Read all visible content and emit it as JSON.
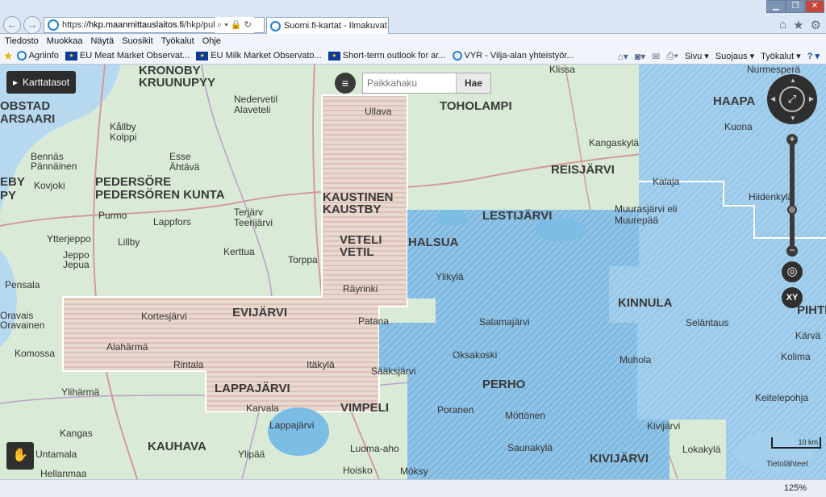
{
  "browser": {
    "url_prefix": "https://",
    "url_domain": "hkp.maanmittauslaitos.fi",
    "url_rest": "/hkp/published",
    "tab_title": "Suomi.fi-kartat - Ilmakuvat ...",
    "tab_close": "✕",
    "nav_back": "←",
    "nav_forward": "→",
    "addr_icons": "⌕ ▾ 🔒 ↻"
  },
  "menu": [
    "Tiedosto",
    "Muokkaa",
    "Näytä",
    "Suosikit",
    "Työkalut",
    "Ohje"
  ],
  "favorites": [
    {
      "label": "Agriinfo",
      "icon": "ie-icon"
    },
    {
      "label": "EU Meat Market Observat...",
      "icon": "eu-flag-icon"
    },
    {
      "label": "EU Milk Market Observato...",
      "icon": "eu-flag-icon"
    },
    {
      "label": "Short-term outlook for ar...",
      "icon": "eu-flag-icon"
    },
    {
      "label": "VYR - Vilja-alan yhteistyör...",
      "icon": "ie-icon"
    }
  ],
  "command_bar": {
    "sivu": "Sivu ▾",
    "suojaus": "Suojaus ▾",
    "tyokalut": "Työkalut ▾",
    "help": "? ▾"
  },
  "map_ui": {
    "layers_label": "Karttatasot",
    "search_placeholder": "Paikkahaku",
    "search_button": "Hae",
    "xy_label": "XY",
    "scale_label": "10 km",
    "credits": "Tietolähteet",
    "compass_center": "⤢",
    "menu_glyph": "≡",
    "zoom_in": "+",
    "zoom_out": "−",
    "locate_glyph": "◎",
    "tool_glyph": "✋"
  },
  "places": [
    {
      "name": "KRONOBY",
      "big": true
    },
    {
      "name": "KRUUNUPYY",
      "big": true
    },
    {
      "name": "OBSTAD",
      "big": true
    },
    {
      "name": "ARSAARI",
      "big": true
    },
    {
      "name": "Nedervetil",
      "big": false
    },
    {
      "name": "Alaveteli",
      "big": false
    },
    {
      "name": "Ullava",
      "big": false
    },
    {
      "name": "TOHOLAMPI",
      "big": true
    },
    {
      "name": "HAAPA",
      "big": true
    },
    {
      "name": "Kuona",
      "big": false
    },
    {
      "name": "Kållby",
      "big": false
    },
    {
      "name": "Kolppi",
      "big": false
    },
    {
      "name": "Bennäs",
      "big": false
    },
    {
      "name": "Pännäinen",
      "big": false
    },
    {
      "name": "Esse",
      "big": false
    },
    {
      "name": "Ähtävä",
      "big": false
    },
    {
      "name": "Kangaskylä",
      "big": false
    },
    {
      "name": "REISJÄRVI",
      "big": true
    },
    {
      "name": "EBY",
      "big": true
    },
    {
      "name": "PY",
      "big": true
    },
    {
      "name": "Kovjoki",
      "big": false
    },
    {
      "name": "PEDERSÖRE",
      "big": true
    },
    {
      "name": "PEDERSÖREN KUNTA",
      "big": true
    },
    {
      "name": "KAUSTINEN",
      "big": true
    },
    {
      "name": "KAUSTBY",
      "big": true
    },
    {
      "name": "Kalaja",
      "big": false
    },
    {
      "name": "Hiidenkylä",
      "big": false
    },
    {
      "name": "Purmo",
      "big": false
    },
    {
      "name": "Terjärv",
      "big": false
    },
    {
      "name": "Teerijärvi",
      "big": false
    },
    {
      "name": "LESTIJÄRVI",
      "big": true
    },
    {
      "name": "Muurasjärvi eli",
      "big": false
    },
    {
      "name": "Muurepää",
      "big": false
    },
    {
      "name": "Lappfors",
      "big": false
    },
    {
      "name": "Ytterjeppo",
      "big": false
    },
    {
      "name": "Lillby",
      "big": false
    },
    {
      "name": "VETELI",
      "big": true
    },
    {
      "name": "VETIL",
      "big": true
    },
    {
      "name": "HALSUA",
      "big": true
    },
    {
      "name": "Jeppo",
      "big": false
    },
    {
      "name": "Jepua",
      "big": false
    },
    {
      "name": "Kerttua",
      "big": false
    },
    {
      "name": "Torppa",
      "big": false
    },
    {
      "name": "Ylikylä",
      "big": false
    },
    {
      "name": "KINNULA",
      "big": true
    },
    {
      "name": "PIHTIPU",
      "big": true
    },
    {
      "name": "Pensala",
      "big": false
    },
    {
      "name": "Räyrinki",
      "big": false
    },
    {
      "name": "Oravais",
      "big": false
    },
    {
      "name": "Oravainen",
      "big": false
    },
    {
      "name": "Kortesjärvi",
      "big": false
    },
    {
      "name": "EVIJÄRVI",
      "big": true
    },
    {
      "name": "Salamajärvi",
      "big": false
    },
    {
      "name": "Seläntaus",
      "big": false
    },
    {
      "name": "Patana",
      "big": false
    },
    {
      "name": "Kärvä",
      "big": false
    },
    {
      "name": "Komossa",
      "big": false
    },
    {
      "name": "Alahärmä",
      "big": false
    },
    {
      "name": "Oksakoski",
      "big": false
    },
    {
      "name": "Muhola",
      "big": false
    },
    {
      "name": "Kolima",
      "big": false
    },
    {
      "name": "Rintala",
      "big": false
    },
    {
      "name": "Itäkylä",
      "big": false
    },
    {
      "name": "Sääksjärvi",
      "big": false
    },
    {
      "name": "PERHO",
      "big": true
    },
    {
      "name": "Ylihärmä",
      "big": false
    },
    {
      "name": "LAPPAJÄRVI",
      "big": true
    },
    {
      "name": "Keitelepohja",
      "big": false
    },
    {
      "name": "Karvala",
      "big": false
    },
    {
      "name": "VIMPELI",
      "big": true
    },
    {
      "name": "Poranen",
      "big": false
    },
    {
      "name": "Möttönen",
      "big": false
    },
    {
      "name": "Kivijärvi",
      "big": false
    },
    {
      "name": "Kangas",
      "big": false
    },
    {
      "name": "Lappajärvi",
      "big": false
    },
    {
      "name": "KAUHAVA",
      "big": true
    },
    {
      "name": "Saunakylä",
      "big": false
    },
    {
      "name": "Lokakylä",
      "big": false
    },
    {
      "name": "Untamala",
      "big": false
    },
    {
      "name": "Ylipää",
      "big": false
    },
    {
      "name": "Luoma-aho",
      "big": false
    },
    {
      "name": "KIVIJÄRVI",
      "big": true
    },
    {
      "name": "Hellanmaa",
      "big": false
    },
    {
      "name": "Hoisko",
      "big": false
    },
    {
      "name": "Möksy",
      "big": false
    },
    {
      "name": "Klissa",
      "big": false
    },
    {
      "name": "Nurmesperä",
      "big": false
    }
  ],
  "status": {
    "zoom": "125%"
  }
}
